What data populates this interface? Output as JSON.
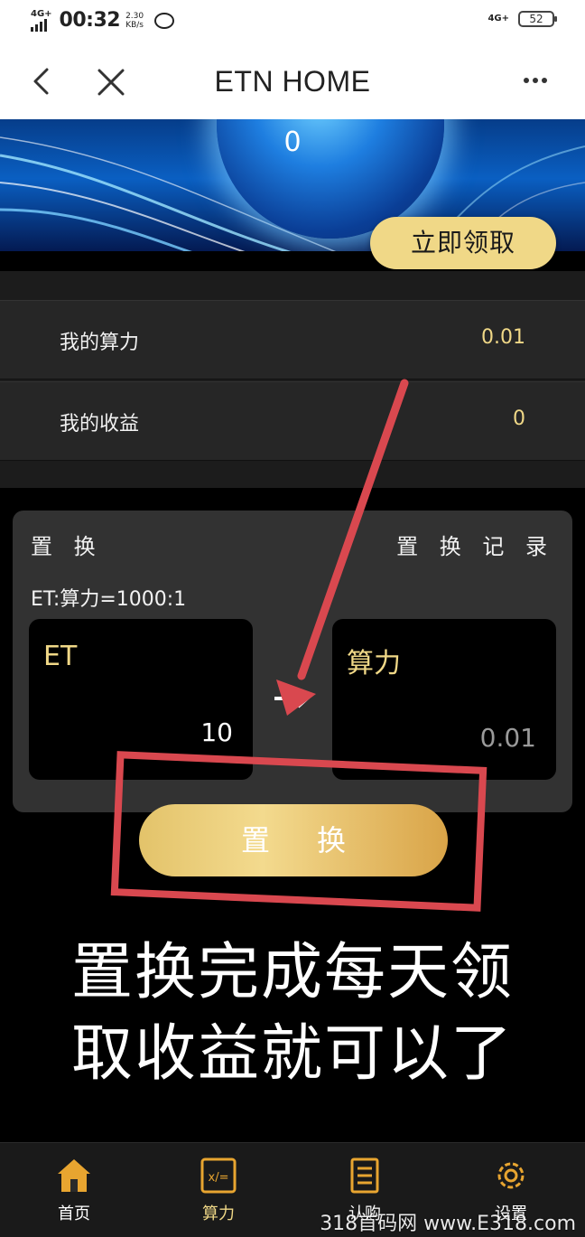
{
  "status_bar": {
    "network_left": "4G+",
    "time": "00:32",
    "speed_value": "2.30",
    "speed_unit": "KB/s",
    "network_right": "4G+",
    "battery": "52"
  },
  "navbar": {
    "title": "ETN HOME"
  },
  "banner": {
    "value": "0",
    "claim_label": "立即领取"
  },
  "stats": [
    {
      "label": "我的算力",
      "value": "0.01"
    },
    {
      "label": "我的收益",
      "value": "0"
    }
  ],
  "exchange": {
    "title": "置 换",
    "record_link": "置 换 记 录",
    "rate": "ET:算力=1000:1",
    "from_label": "ET",
    "from_value": "10",
    "to_label": "算力",
    "to_value": "0.01",
    "submit_label": "置换"
  },
  "annotation": {
    "caption_line1": "置换完成每天领",
    "caption_line2": "取收益就可以了"
  },
  "tabs": [
    {
      "label": "首页",
      "icon": "home-icon"
    },
    {
      "label": "算力",
      "icon": "calculator-icon"
    },
    {
      "label": "认购",
      "icon": "receipt-icon"
    },
    {
      "label": "设置",
      "icon": "gear-icon"
    }
  ],
  "active_tab": 1,
  "colors": {
    "accent_gold": "#f0d887",
    "annotation_red": "#d9484f",
    "background": "#000000"
  },
  "watermark": "318首码网 www.E318.com"
}
